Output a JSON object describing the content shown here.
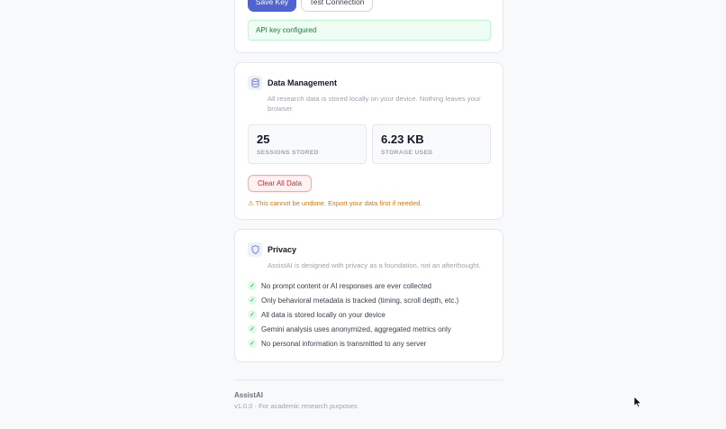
{
  "api": {
    "save_label": "Save Key",
    "test_label": "Test Connection",
    "status": "API key configured"
  },
  "data_management": {
    "icon": "database-icon",
    "title": "Data Management",
    "description": "All research data is stored locally on your device. Nothing leaves your browser.",
    "stats": [
      {
        "value": "25",
        "label": "SESSIONS STORED"
      },
      {
        "value": "6.23 KB",
        "label": "STORAGE USED"
      }
    ],
    "clear_label": "Clear All Data",
    "warning": "⚠ This cannot be undone. Export your data first if needed."
  },
  "privacy": {
    "icon": "shield-icon",
    "title": "Privacy",
    "description": "AssistAI is designed with privacy as a foundation, not an afterthought.",
    "items": [
      "No prompt content or AI responses are ever collected",
      "Only behavioral metadata is tracked (timing, scroll depth, etc.)",
      "All data is stored locally on your device",
      "Gemini analysis uses anonymized, aggregated metrics only",
      "No personal information is transmitted to any server"
    ]
  },
  "footer": {
    "app_name": "AssistAI",
    "version": "v1.0.0 · For academic research purposes"
  },
  "colors": {
    "primary": "#4f63d2",
    "success": "#15803d",
    "danger": "#dc2626",
    "warning": "#d97706"
  }
}
